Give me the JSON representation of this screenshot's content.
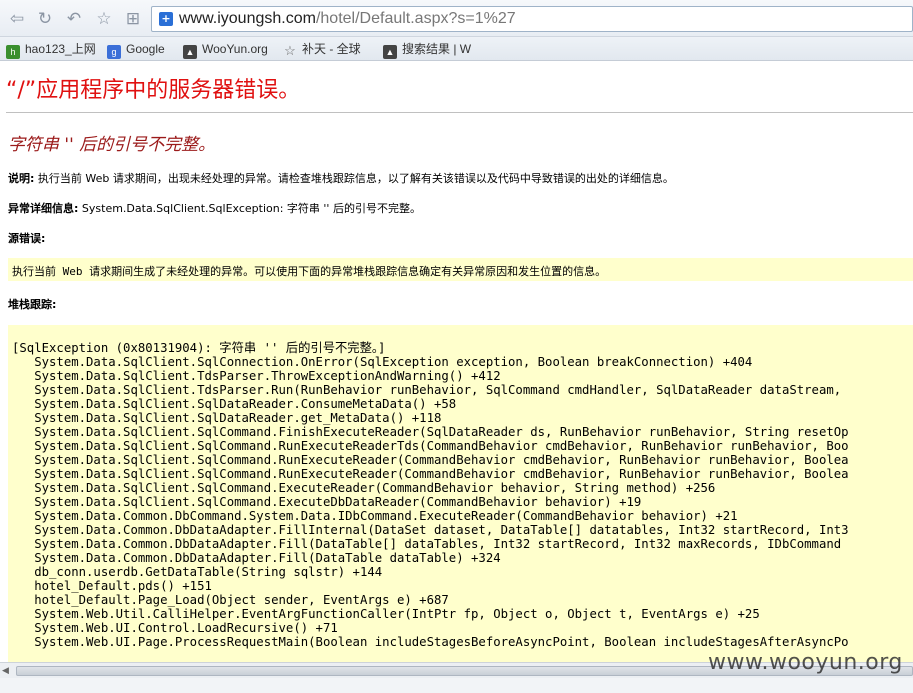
{
  "browser": {
    "url_host": "www.iyoungsh.com",
    "url_path": "/hotel/Default.aspx?s=1%27",
    "bookmarks": [
      {
        "label": "hao123_上网",
        "icon": "hao123-icon"
      },
      {
        "label": "Google",
        "icon": "google-icon"
      },
      {
        "label": "WooYun.org",
        "icon": "wooyun-icon"
      },
      {
        "label": "补天 - 全球",
        "icon": "butian-star-icon"
      },
      {
        "label": "搜索结果 | W",
        "icon": "search-results-icon"
      }
    ]
  },
  "page": {
    "title": "“/”应用程序中的服务器错误。",
    "subtitle": "字符串 '' 后的引号不完整。",
    "desc_label": "说明:",
    "desc_text": " 执行当前 Web 请求期间，出现未经处理的异常。请检查堆栈跟踪信息，以了解有关该错误以及代码中导致错误的出处的详细信息。",
    "exception_label": "异常详细信息:",
    "exception_text": " System.Data.SqlClient.SqlException: 字符串 '' 后的引号不完整。",
    "source_label": "源错误:",
    "source_text": "执行当前 Web 请求期间生成了未经处理的异常。可以使用下面的异常堆栈跟踪信息确定有关异常原因和发生位置的信息。",
    "stack_label": "堆栈跟踪:",
    "stack_lines": [
      "[SqlException (0x80131904): 字符串 '' 后的引号不完整。]",
      "   System.Data.SqlClient.SqlConnection.OnError(SqlException exception, Boolean breakConnection) +404",
      "   System.Data.SqlClient.TdsParser.ThrowExceptionAndWarning() +412",
      "   System.Data.SqlClient.TdsParser.Run(RunBehavior runBehavior, SqlCommand cmdHandler, SqlDataReader dataStream,",
      "   System.Data.SqlClient.SqlDataReader.ConsumeMetaData() +58",
      "   System.Data.SqlClient.SqlDataReader.get_MetaData() +118",
      "   System.Data.SqlClient.SqlCommand.FinishExecuteReader(SqlDataReader ds, RunBehavior runBehavior, String resetOp",
      "   System.Data.SqlClient.SqlCommand.RunExecuteReaderTds(CommandBehavior cmdBehavior, RunBehavior runBehavior, Boo",
      "   System.Data.SqlClient.SqlCommand.RunExecuteReader(CommandBehavior cmdBehavior, RunBehavior runBehavior, Boolea",
      "   System.Data.SqlClient.SqlCommand.RunExecuteReader(CommandBehavior cmdBehavior, RunBehavior runBehavior, Boolea",
      "   System.Data.SqlClient.SqlCommand.ExecuteReader(CommandBehavior behavior, String method) +256",
      "   System.Data.SqlClient.SqlCommand.ExecuteDbDataReader(CommandBehavior behavior) +19",
      "   System.Data.Common.DbCommand.System.Data.IDbCommand.ExecuteReader(CommandBehavior behavior) +21",
      "   System.Data.Common.DbDataAdapter.FillInternal(DataSet dataset, DataTable[] datatables, Int32 startRecord, Int3",
      "   System.Data.Common.DbDataAdapter.Fill(DataTable[] dataTables, Int32 startRecord, Int32 maxRecords, IDbCommand",
      "   System.Data.Common.DbDataAdapter.Fill(DataTable dataTable) +324",
      "   db_conn.userdb.GetDataTable(String sqlstr) +144",
      "   hotel_Default.pds() +151",
      "   hotel_Default.Page_Load(Object sender, EventArgs e) +687",
      "   System.Web.Util.CalliHelper.EventArgFunctionCaller(IntPtr fp, Object o, Object t, EventArgs e) +25",
      "   System.Web.UI.Control.LoadRecursive() +71",
      "   System.Web.UI.Page.ProcessRequestMain(Boolean includeStagesBeforeAsyncPoint, Boolean includeStagesAfterAsyncPo"
    ]
  },
  "watermark": "www.wooyun.org"
}
